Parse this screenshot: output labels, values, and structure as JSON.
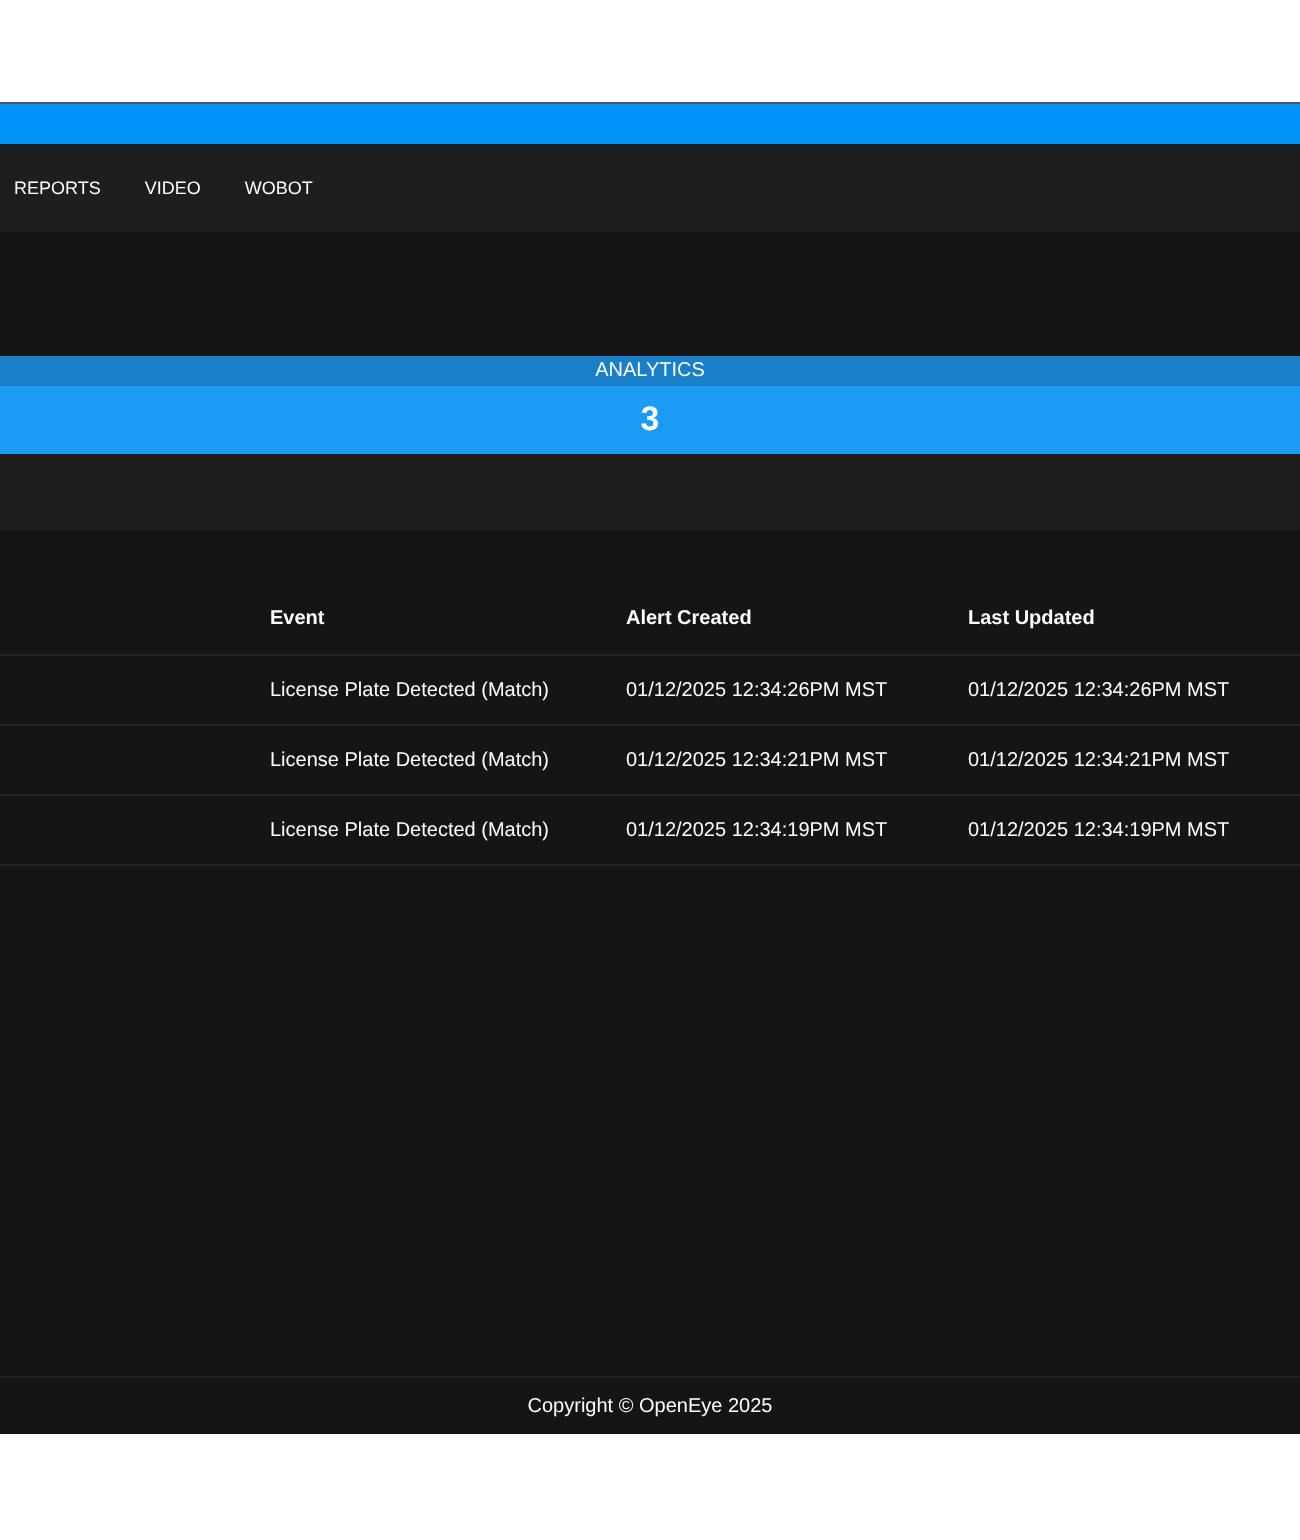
{
  "nav": {
    "items": [
      {
        "label": "REPORTS"
      },
      {
        "label": "VIDEO"
      },
      {
        "label": "WOBOT"
      }
    ]
  },
  "analytics": {
    "title": "ANALYTICS",
    "count": "3"
  },
  "table": {
    "columns": [
      "Event",
      "Alert Created",
      "Last Updated"
    ],
    "rows": [
      [
        "License Plate Detected (Match)",
        "01/12/2025 12:34:26PM MST",
        "01/12/2025 12:34:26PM MST"
      ],
      [
        "License Plate Detected (Match)",
        "01/12/2025 12:34:21PM MST",
        "01/12/2025 12:34:21PM MST"
      ],
      [
        "License Plate Detected (Match)",
        "01/12/2025 12:34:19PM MST",
        "01/12/2025 12:34:19PM MST"
      ]
    ]
  },
  "footer": {
    "text": "Copyright © OpenEye 2025"
  }
}
